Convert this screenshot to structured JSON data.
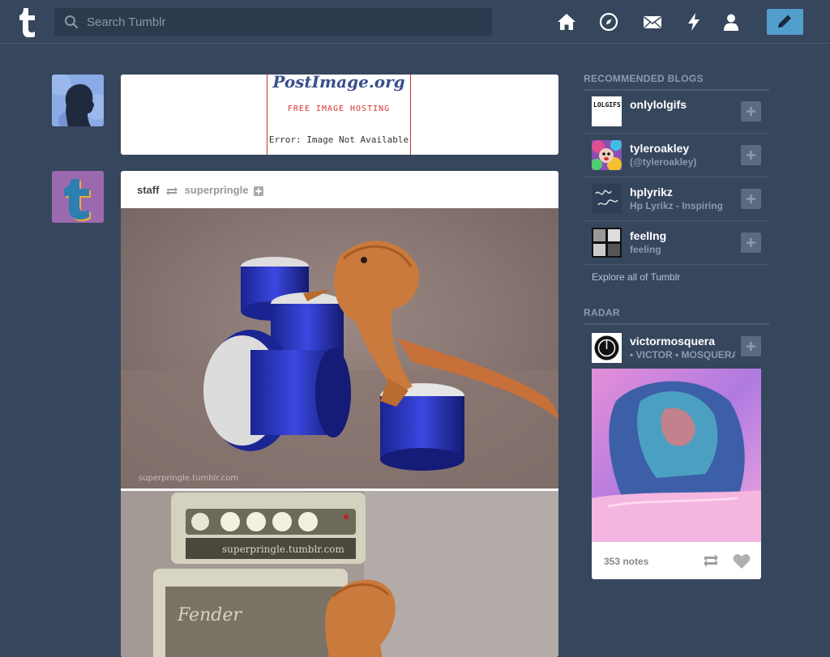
{
  "header": {
    "logo": "t",
    "search_placeholder": "Search Tumblr",
    "nav_icons": [
      "home-icon",
      "explore-compass-icon",
      "inbox-mail-icon",
      "activity-lightning-icon",
      "account-person-icon"
    ],
    "compose_icon": "pencil-icon",
    "compose_color": "#529ecc"
  },
  "posts": [
    {
      "image": {
        "brand": "PostImage.org",
        "tagline": "FREE IMAGE HOSTING",
        "error": "Error: Image Not Available"
      }
    },
    {
      "author": "staff",
      "reblogged_from": "superpringle",
      "photo_watermark_1": "superpringle.tumblr.com",
      "photo_watermark_2": "superpringle.tumblr.com"
    }
  ],
  "sidebar": {
    "recommended_title": "RECOMMENDED BLOGS",
    "blogs": [
      {
        "name": "onlylolgifs",
        "subtitle": "",
        "avatar_text": "LOLGIFS.NET"
      },
      {
        "name": "tyleroakley",
        "subtitle": "(@tyleroakley)"
      },
      {
        "name": "hplyrikz",
        "subtitle": "Hp Lyrikz - Inspiring"
      },
      {
        "name": "feelIng",
        "subtitle": "feeling"
      }
    ],
    "explore_link": "Explore all of Tumblr",
    "radar_title": "RADAR",
    "radar": {
      "name": "victormosquera",
      "subtitle": "• VICTOR • MOSQUERA",
      "notes": "353 notes"
    }
  }
}
